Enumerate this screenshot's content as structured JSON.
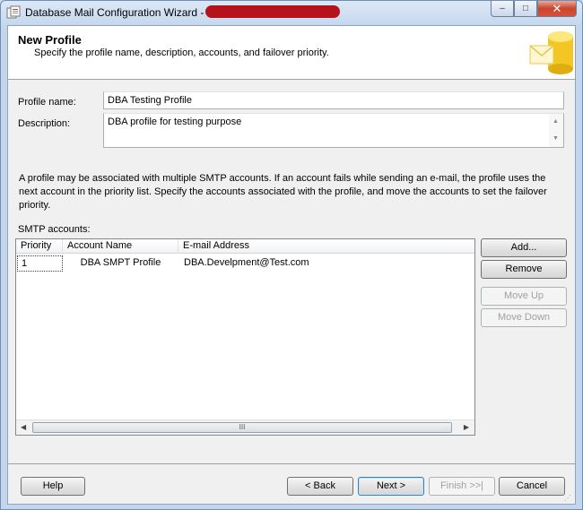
{
  "window": {
    "title": "Database Mail Configuration Wizard -",
    "controls": {
      "minimize": "–",
      "maximize": "□",
      "close": "✕"
    }
  },
  "header": {
    "title": "New Profile",
    "subtitle": "Specify the profile name, description, accounts, and failover priority."
  },
  "form": {
    "profile_name_label": "Profile name:",
    "profile_name_value": "DBA Testing Profile",
    "description_label": "Description:",
    "description_value": "DBA profile for testing purpose"
  },
  "info_text": "A profile may be associated with multiple SMTP accounts. If an account fails while sending an e-mail, the profile uses the next account in the priority list. Specify the accounts associated with the profile, and move the accounts to set the failover priority.",
  "smtp": {
    "label": "SMTP accounts:",
    "columns": [
      "Priority",
      "Account Name",
      "E-mail Address"
    ],
    "rows": [
      {
        "priority": "1",
        "account_name": "DBA SMPT Profile",
        "email": "DBA.Develpment@Test.com"
      }
    ],
    "scroll_thumb": "III"
  },
  "side_buttons": {
    "add": "Add...",
    "remove": "Remove",
    "move_up": "Move Up",
    "move_down": "Move Down"
  },
  "footer_buttons": {
    "help": "Help",
    "back": "< Back",
    "next": "Next >",
    "finish": "Finish >>|",
    "cancel": "Cancel"
  },
  "colors": {
    "titlebar": "#c3d6ee",
    "default_button_border": "#3c7fb1",
    "redaction": "#b5121b"
  }
}
